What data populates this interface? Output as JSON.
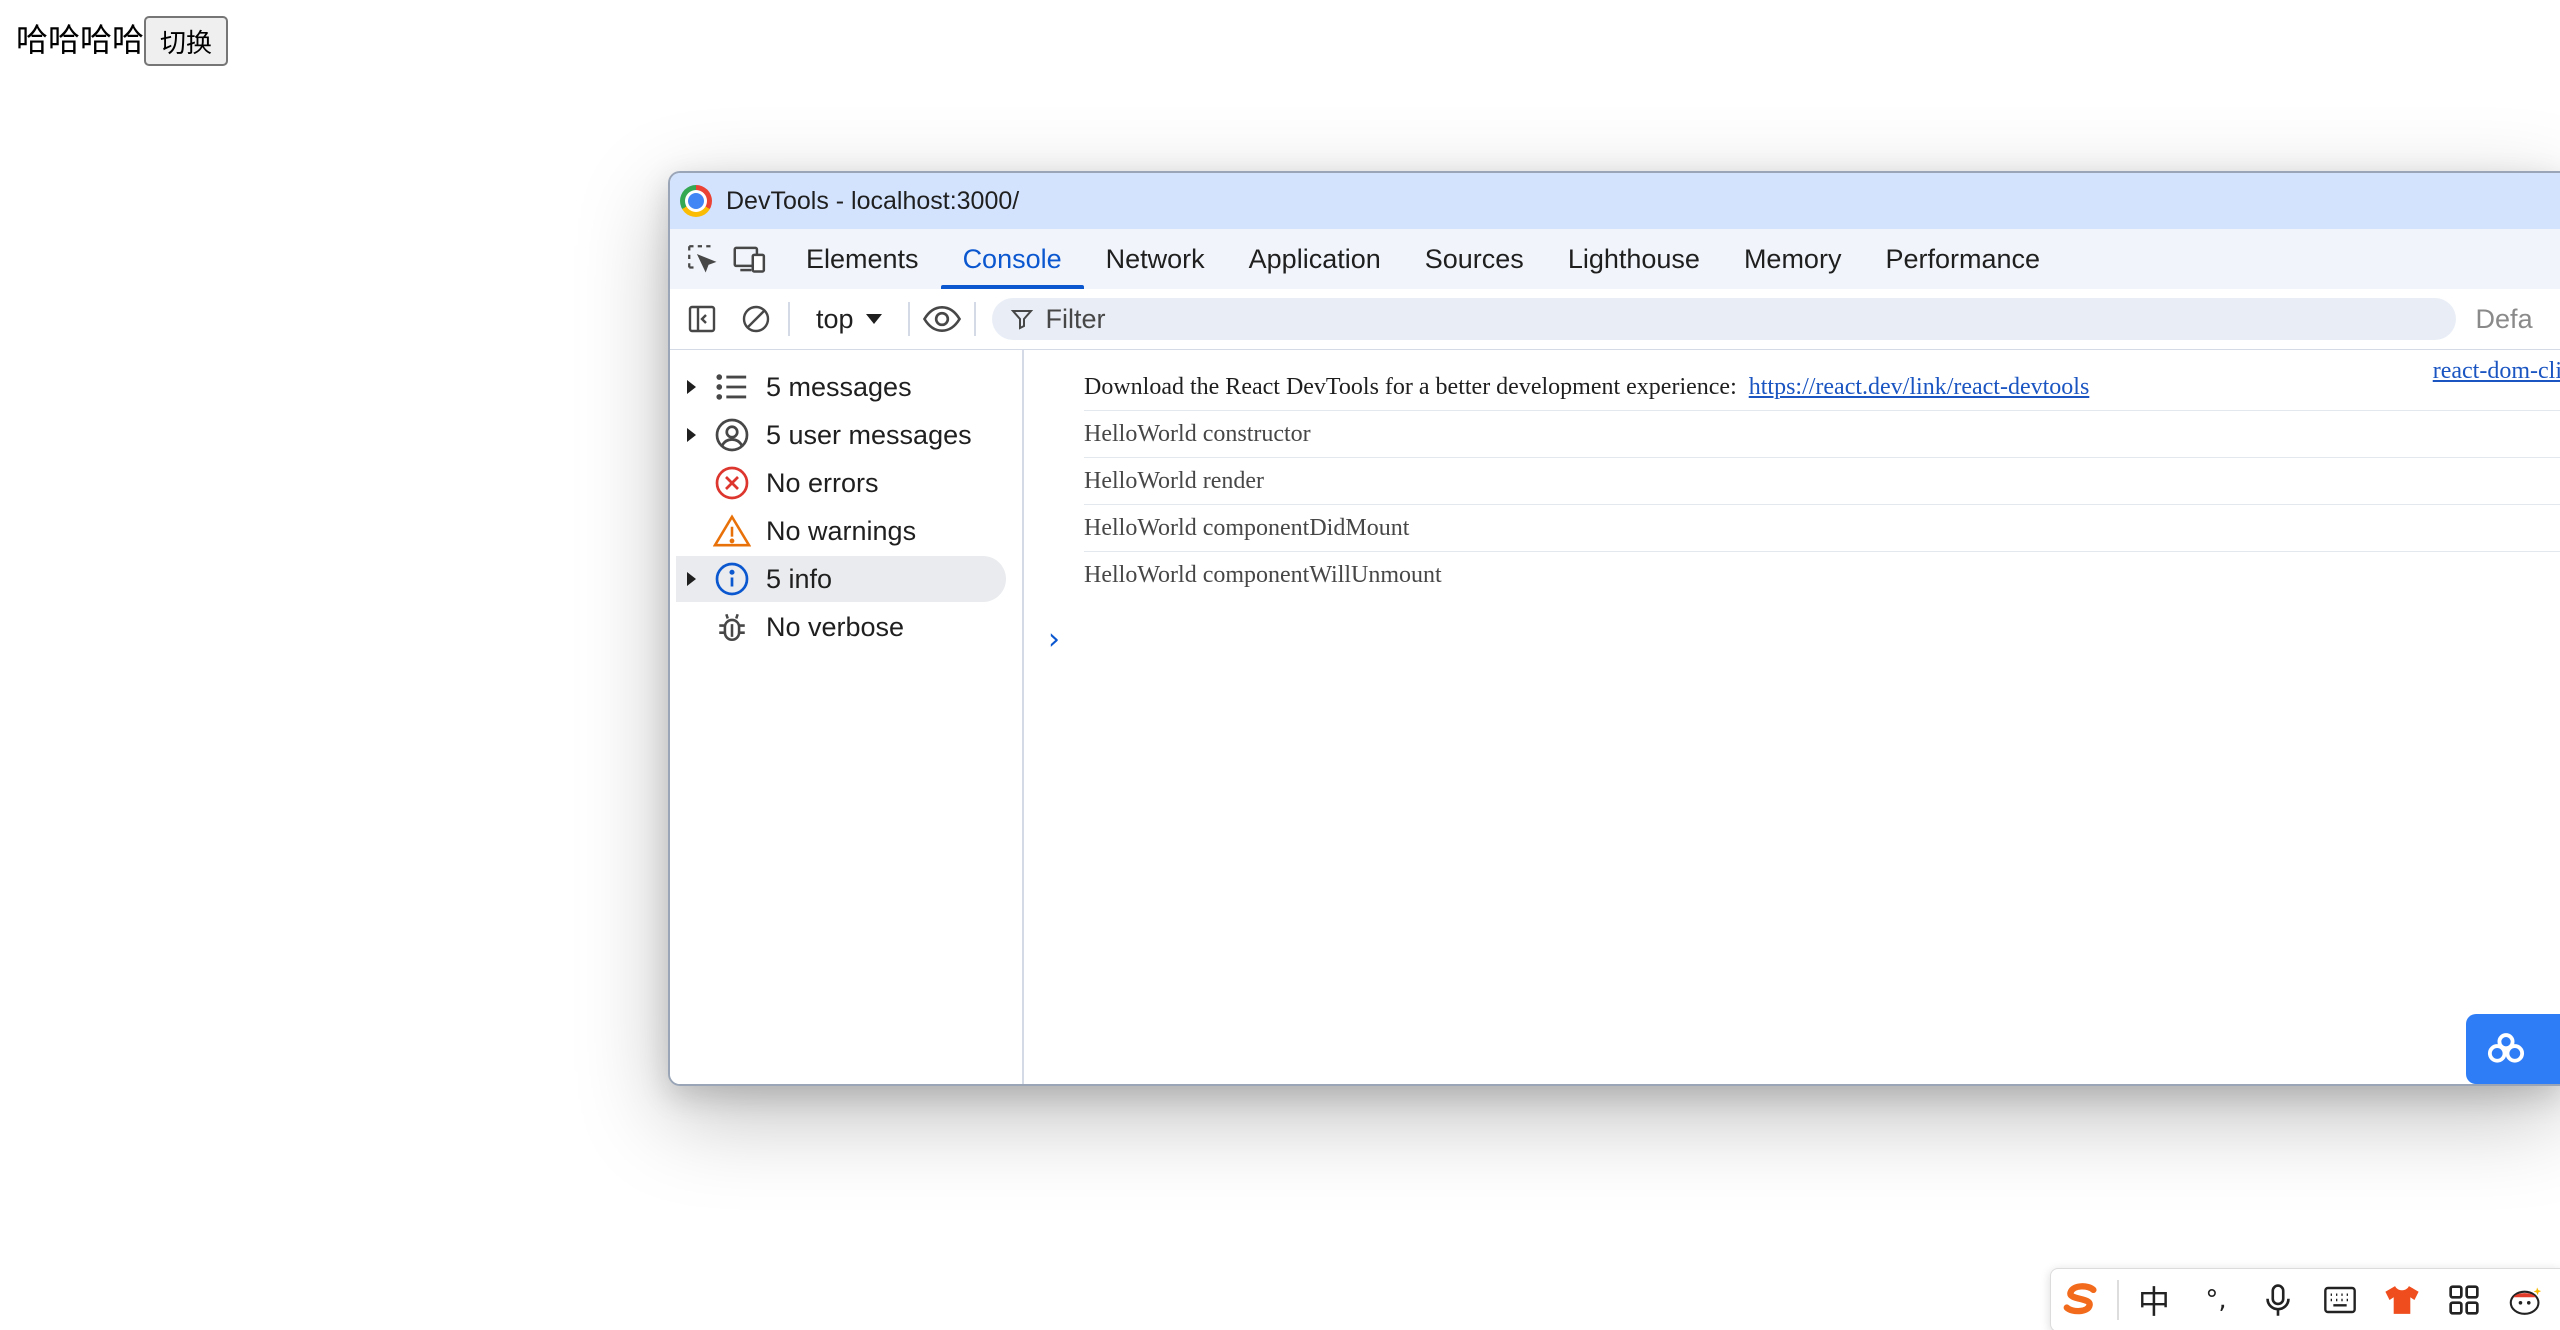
{
  "page": {
    "text": "哈哈哈哈",
    "button_label": "切换"
  },
  "devtools": {
    "window_title": "DevTools - localhost:3000/",
    "tabs": [
      {
        "label": "Elements"
      },
      {
        "label": "Console",
        "active": true
      },
      {
        "label": "Network"
      },
      {
        "label": "Application"
      },
      {
        "label": "Sources"
      },
      {
        "label": "Lighthouse"
      },
      {
        "label": "Memory"
      },
      {
        "label": "Performance"
      }
    ],
    "toolbar": {
      "context": "top",
      "filter_placeholder": "Filter",
      "levels_label": "Defa"
    },
    "sidebar": {
      "items": [
        {
          "label": "5 messages",
          "icon": "list-icon",
          "expandable": true
        },
        {
          "label": "5 user messages",
          "icon": "user-circle-icon",
          "expandable": true
        },
        {
          "label": "No errors",
          "icon": "error-icon",
          "expandable": false
        },
        {
          "label": "No warnings",
          "icon": "warning-icon",
          "expandable": false
        },
        {
          "label": "5 info",
          "icon": "info-icon",
          "expandable": true,
          "selected": true
        },
        {
          "label": "No verbose",
          "icon": "bug-icon",
          "expandable": false
        }
      ]
    },
    "console": {
      "source_link": "react-dom-cli",
      "messages": [
        {
          "text": "Download the React DevTools for a better development experience: ",
          "link": "https://react.dev/link/react-devtools"
        },
        {
          "text": "HelloWorld constructor"
        },
        {
          "text": "HelloWorld render"
        },
        {
          "text": "HelloWorld componentDidMount"
        },
        {
          "text": "HelloWorld componentWillUnmount"
        }
      ],
      "prompt": "›"
    }
  },
  "ime": {
    "items": [
      {
        "icon": "sogou-logo-icon"
      },
      {
        "label": "中"
      },
      {
        "label": "°,"
      },
      {
        "icon": "microphone-icon"
      },
      {
        "icon": "keyboard-icon"
      },
      {
        "icon": "shirt-icon"
      },
      {
        "icon": "grid-icon"
      },
      {
        "icon": "mascot-icon"
      }
    ]
  },
  "colors": {
    "accent": "#0b57d0",
    "titlebar": "#d3e3fd",
    "error": "#dc362e",
    "warning": "#e8710a",
    "info": "#0b57d0"
  }
}
